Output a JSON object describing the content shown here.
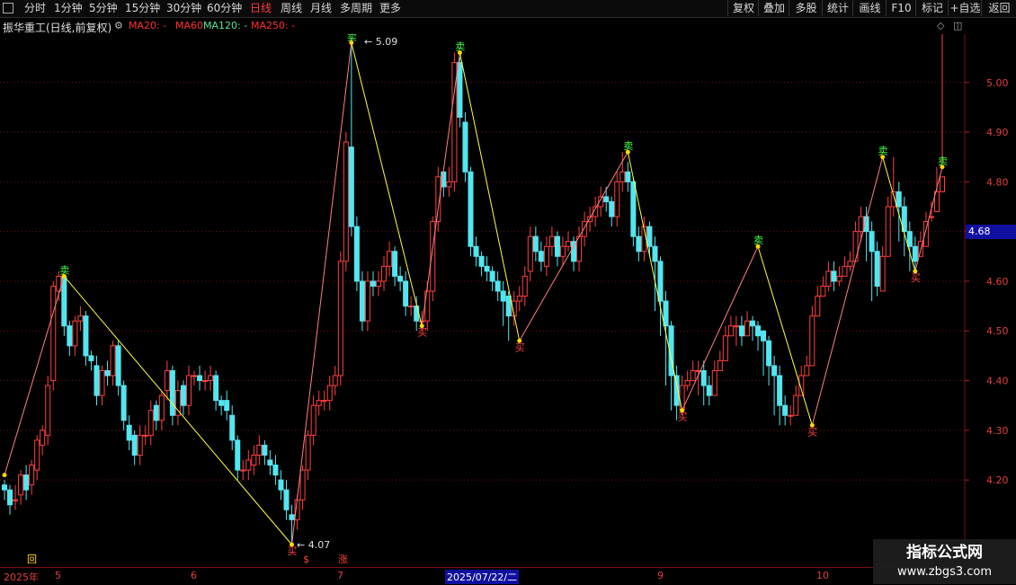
{
  "toolbar": {
    "periods": [
      "分时",
      "1分钟",
      "5分钟",
      "15分钟",
      "30分钟",
      "60分钟",
      "日线",
      "周线",
      "月线",
      "多周期",
      "更多"
    ],
    "active_period": "日线",
    "right_buttons": [
      "复权",
      "叠加",
      "多股",
      "统计",
      "画线",
      "F10",
      "标记",
      "+自选",
      "返回"
    ]
  },
  "info": {
    "title": "振华重工(日线,前复权)",
    "ma20": "MA20: -",
    "ma60": "MA60: -",
    "ma120": "MA120: -",
    "ma250": "MA250: -"
  },
  "colors": {
    "up": "#ff4040",
    "down": "#52e6f0",
    "grid": "#7a1010",
    "zigzag_up": "#ff8080",
    "zigzag_down": "#ffff40"
  },
  "axis": {
    "current_price": "4.68",
    "x_labels": [
      "2025年",
      "5",
      "6",
      "7",
      "2025/07/22/二",
      "9",
      "10"
    ],
    "x_markers": [
      "回",
      "$",
      "涨"
    ]
  },
  "watermark": {
    "line1": "指标公式网",
    "line2": "www.zbgs3.com"
  },
  "chart_data": {
    "type": "candlestick",
    "title": "振华重工(日线,前复权)",
    "ylim": [
      4.1,
      5.1
    ],
    "yticks": [
      4.2,
      4.3,
      4.4,
      4.5,
      4.6,
      4.7,
      4.8,
      4.9,
      5.0
    ],
    "grid": true,
    "annotations": {
      "high": "5.09",
      "low": "4.07"
    },
    "zigzag": [
      {
        "i": 0,
        "price": 4.21
      },
      {
        "i": 11,
        "price": 4.61,
        "mark": "卖"
      },
      {
        "i": 53,
        "price": 4.07,
        "mark": "买"
      },
      {
        "i": 64,
        "price": 5.08,
        "mark": "卖"
      },
      {
        "i": 77,
        "price": 4.51,
        "mark": "买"
      },
      {
        "i": 84,
        "price": 5.06,
        "mark": "卖"
      },
      {
        "i": 95,
        "price": 4.48,
        "mark": "买"
      },
      {
        "i": 115,
        "price": 4.86,
        "mark": "卖"
      },
      {
        "i": 125,
        "price": 4.34,
        "mark": "买"
      },
      {
        "i": 139,
        "price": 4.67,
        "mark": "卖"
      },
      {
        "i": 149,
        "price": 4.31,
        "mark": "买"
      },
      {
        "i": 162,
        "price": 4.85,
        "mark": "卖"
      },
      {
        "i": 168,
        "price": 4.62,
        "mark": "买"
      },
      {
        "i": 173,
        "price": 4.83,
        "mark": "卖"
      }
    ],
    "candles": {
      "o": [
        4.19,
        4.18,
        4.16,
        4.17,
        4.21,
        4.19,
        4.22,
        4.27,
        4.29,
        4.4,
        4.58,
        4.61,
        4.51,
        4.47,
        4.52,
        4.53,
        4.45,
        4.43,
        4.37,
        4.42,
        4.41,
        4.47,
        4.39,
        4.31,
        4.29,
        4.25,
        4.29,
        4.29,
        4.35,
        4.32,
        4.38,
        4.42,
        4.33,
        4.39,
        4.35,
        4.41,
        4.41,
        4.4,
        4.4,
        4.41,
        4.36,
        4.36,
        4.33,
        4.28,
        4.22,
        4.22,
        4.23,
        4.25,
        4.27,
        4.24,
        4.23,
        4.2,
        4.18,
        4.13,
        4.12,
        4.16,
        4.22,
        4.29,
        4.35,
        4.36,
        4.36,
        4.39,
        4.41,
        4.64,
        4.87,
        4.71,
        4.6,
        4.52,
        4.6,
        4.59,
        4.6,
        4.63,
        4.66,
        4.61,
        4.6,
        4.55,
        4.55,
        4.52,
        4.52,
        4.58,
        4.72,
        4.82,
        4.79,
        4.8,
        5.04,
        4.92,
        4.82,
        4.67,
        4.65,
        4.63,
        4.62,
        4.6,
        4.58,
        4.57,
        4.53,
        4.56,
        4.57,
        4.62,
        4.69,
        4.66,
        4.63,
        4.67,
        4.69,
        4.65,
        4.67,
        4.68,
        4.64,
        4.69,
        4.72,
        4.73,
        4.75,
        4.77,
        4.76,
        4.73,
        4.8,
        4.82,
        4.8,
        4.69,
        4.66,
        4.71,
        4.67,
        4.64,
        4.56,
        4.51,
        4.41,
        4.34,
        4.39,
        4.4,
        4.42,
        4.42,
        4.39,
        4.37,
        4.42,
        4.44,
        4.49,
        4.51,
        4.51,
        4.49,
        4.52,
        4.51,
        4.5,
        4.48,
        4.43,
        4.41,
        4.35,
        4.33,
        4.33,
        4.37,
        4.41,
        4.43,
        4.53,
        4.57,
        4.59,
        4.62,
        4.6,
        4.61,
        4.63,
        4.64,
        4.7,
        4.73,
        4.7,
        4.66,
        4.58,
        4.65,
        4.75,
        4.78,
        4.75,
        4.7,
        4.67,
        4.65,
        4.67,
        4.73,
        4.74,
        4.78
      ],
      "c": [
        4.18,
        4.15,
        4.16,
        4.21,
        4.18,
        4.23,
        4.28,
        4.3,
        4.39,
        4.59,
        4.61,
        4.51,
        4.47,
        4.52,
        4.53,
        4.45,
        4.44,
        4.37,
        4.42,
        4.41,
        4.47,
        4.39,
        4.32,
        4.28,
        4.25,
        4.29,
        4.29,
        4.34,
        4.32,
        4.37,
        4.42,
        4.33,
        4.38,
        4.35,
        4.41,
        4.41,
        4.4,
        4.4,
        4.41,
        4.36,
        4.35,
        4.34,
        4.28,
        4.22,
        4.22,
        4.24,
        4.25,
        4.27,
        4.25,
        4.23,
        4.21,
        4.18,
        4.14,
        4.12,
        4.16,
        4.22,
        4.29,
        4.35,
        4.36,
        4.36,
        4.39,
        4.41,
        4.64,
        4.88,
        4.71,
        4.6,
        4.52,
        4.6,
        4.59,
        4.6,
        4.63,
        4.66,
        4.61,
        4.6,
        4.55,
        4.55,
        4.52,
        4.52,
        4.58,
        4.72,
        4.81,
        4.79,
        4.8,
        5.04,
        4.93,
        4.82,
        4.67,
        4.65,
        4.63,
        4.62,
        4.6,
        4.58,
        4.56,
        4.53,
        4.56,
        4.57,
        4.61,
        4.69,
        4.66,
        4.64,
        4.67,
        4.69,
        4.65,
        4.67,
        4.68,
        4.64,
        4.69,
        4.72,
        4.73,
        4.75,
        4.77,
        4.76,
        4.73,
        4.8,
        4.82,
        4.8,
        4.69,
        4.66,
        4.71,
        4.67,
        4.64,
        4.56,
        4.51,
        4.41,
        4.35,
        4.39,
        4.4,
        4.42,
        4.42,
        4.39,
        4.37,
        4.42,
        4.44,
        4.49,
        4.51,
        4.51,
        4.49,
        4.52,
        4.51,
        4.49,
        4.48,
        4.43,
        4.41,
        4.35,
        4.33,
        4.33,
        4.37,
        4.41,
        4.43,
        4.53,
        4.57,
        4.59,
        4.62,
        4.6,
        4.61,
        4.63,
        4.64,
        4.7,
        4.73,
        4.7,
        4.66,
        4.59,
        4.65,
        4.75,
        4.78,
        4.75,
        4.7,
        4.67,
        4.64,
        4.68,
        4.72,
        4.73,
        4.78,
        4.81
      ],
      "h": [
        4.2,
        4.19,
        4.19,
        4.22,
        4.23,
        4.24,
        4.29,
        4.31,
        4.41,
        4.6,
        4.62,
        4.61,
        4.52,
        4.53,
        4.55,
        4.54,
        4.46,
        4.45,
        4.43,
        4.44,
        4.48,
        4.48,
        4.4,
        4.33,
        4.3,
        4.31,
        4.31,
        4.36,
        4.36,
        4.38,
        4.44,
        4.43,
        4.4,
        4.4,
        4.43,
        4.42,
        4.43,
        4.42,
        4.43,
        4.42,
        4.37,
        4.38,
        4.35,
        4.29,
        4.24,
        4.26,
        4.27,
        4.29,
        4.28,
        4.26,
        4.25,
        4.22,
        4.2,
        4.15,
        4.17,
        4.23,
        4.3,
        4.37,
        4.38,
        4.38,
        4.41,
        4.43,
        4.66,
        4.9,
        5.09,
        4.73,
        4.62,
        4.62,
        4.62,
        4.62,
        4.65,
        4.68,
        4.67,
        4.63,
        4.62,
        4.57,
        4.57,
        4.54,
        4.6,
        4.73,
        4.83,
        4.82,
        4.83,
        5.06,
        5.05,
        4.94,
        4.83,
        4.69,
        4.66,
        4.65,
        4.63,
        4.62,
        4.6,
        4.58,
        4.58,
        4.59,
        4.63,
        4.71,
        4.71,
        4.68,
        4.69,
        4.71,
        4.7,
        4.69,
        4.7,
        4.69,
        4.71,
        4.74,
        4.75,
        4.77,
        4.79,
        4.79,
        4.77,
        4.82,
        4.86,
        4.84,
        4.81,
        4.71,
        4.73,
        4.72,
        4.69,
        4.65,
        4.58,
        4.52,
        4.43,
        4.41,
        4.42,
        4.44,
        4.44,
        4.44,
        4.41,
        4.44,
        4.46,
        4.51,
        4.53,
        4.53,
        4.53,
        4.54,
        4.53,
        4.52,
        4.5,
        4.49,
        4.45,
        4.43,
        4.37,
        4.35,
        4.39,
        4.43,
        4.45,
        4.55,
        4.59,
        4.61,
        4.64,
        4.64,
        4.63,
        4.65,
        4.66,
        4.72,
        4.75,
        4.75,
        4.72,
        4.68,
        4.67,
        4.77,
        4.85,
        4.8,
        4.77,
        4.72,
        4.69,
        4.7,
        4.74,
        4.76,
        4.83,
        4.84
      ],
      "l": [
        4.16,
        4.13,
        4.14,
        4.15,
        4.16,
        4.17,
        4.2,
        4.25,
        4.27,
        4.38,
        4.56,
        4.49,
        4.45,
        4.45,
        4.5,
        4.43,
        4.42,
        4.35,
        4.35,
        4.39,
        4.39,
        4.37,
        4.3,
        4.26,
        4.23,
        4.23,
        4.27,
        4.27,
        4.3,
        4.3,
        4.36,
        4.31,
        4.31,
        4.33,
        4.33,
        4.39,
        4.38,
        4.38,
        4.38,
        4.34,
        4.33,
        4.32,
        4.26,
        4.2,
        4.2,
        4.2,
        4.21,
        4.23,
        4.23,
        4.21,
        4.19,
        4.16,
        4.12,
        4.07,
        4.1,
        4.14,
        4.2,
        4.27,
        4.33,
        4.34,
        4.34,
        4.37,
        4.39,
        4.62,
        4.69,
        4.58,
        4.5,
        4.5,
        4.57,
        4.57,
        4.58,
        4.61,
        4.59,
        4.58,
        4.53,
        4.53,
        4.5,
        4.5,
        4.5,
        4.56,
        4.7,
        4.77,
        4.77,
        4.78,
        4.91,
        4.8,
        4.65,
        4.63,
        4.61,
        4.6,
        4.58,
        4.56,
        4.51,
        4.48,
        4.51,
        4.54,
        4.55,
        4.6,
        4.64,
        4.62,
        4.61,
        4.65,
        4.63,
        4.63,
        4.66,
        4.62,
        4.62,
        4.67,
        4.7,
        4.71,
        4.73,
        4.74,
        4.71,
        4.71,
        4.78,
        4.78,
        4.67,
        4.64,
        4.64,
        4.65,
        4.54,
        4.49,
        4.39,
        4.34,
        4.32,
        4.33,
        4.38,
        4.4,
        4.37,
        4.35,
        4.35,
        4.4,
        4.42,
        4.47,
        4.49,
        4.47,
        4.47,
        4.49,
        4.48,
        4.46,
        4.41,
        4.39,
        4.33,
        4.31,
        4.31,
        4.31,
        4.35,
        4.39,
        4.41,
        4.51,
        4.55,
        4.57,
        4.58,
        4.58,
        4.59,
        4.61,
        4.62,
        4.68,
        4.68,
        4.64,
        4.56,
        4.57,
        4.63,
        4.73,
        4.73,
        4.68,
        4.65,
        4.62,
        4.62,
        4.66,
        4.7,
        4.72,
        4.76
      ]
    }
  }
}
